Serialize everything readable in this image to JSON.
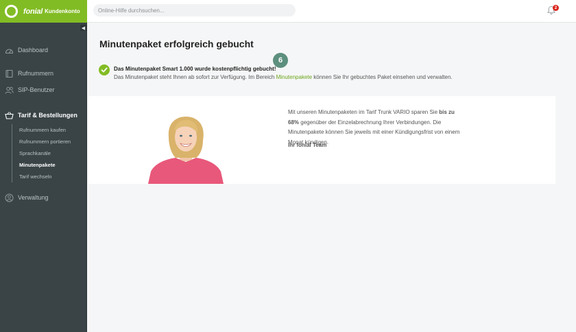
{
  "header": {
    "brand_name": "fonial",
    "brand_sub": "Kundenkonto",
    "search_placeholder": "Online-Hilfe durchsuchen...",
    "notification_count": "2"
  },
  "sidebar": {
    "items": [
      {
        "label": "Dashboard"
      },
      {
        "label": "Rufnummern"
      },
      {
        "label": "SIP-Benutzer"
      },
      {
        "label": "Tarif & Bestellungen"
      },
      {
        "label": "Verwaltung"
      }
    ],
    "subitems": [
      {
        "label": "Rufnummern kaufen"
      },
      {
        "label": "Rufnummern portieren"
      },
      {
        "label": "Sprachkanäle"
      },
      {
        "label": "Minutenpakete"
      },
      {
        "label": "Tarif wechseln"
      }
    ]
  },
  "main": {
    "title": "Minutenpaket erfolgreich gebucht",
    "step_badge": "6",
    "success_title": "Das Minutenpaket Smart 1.000 wurde kostenpflichtig gebucht!",
    "success_text_before": "Das Minutenpaket steht Ihnen ab sofort zur Verfügung. Im Bereich ",
    "success_link": "Minutenpakete",
    "success_text_after": " können Sie Ihr gebuchtes Paket einsehen und verwalten.",
    "promo_text_before": "Mit unseren Minutenpaketen im Tarif Trunk VARIO sparen Sie ",
    "promo_text_bold": "bis zu 68%",
    "promo_text_after": " gegenüber der Einzelabrechnung Ihrer Verbindungen. Die Minutenpakete können Sie jeweils mit einer Kündigungsfrist von einem Monat kündigen.",
    "promo_sign": "Ihr fonial Team"
  },
  "colors": {
    "brand_green": "#82bc24",
    "sidebar_bg": "#3a4447",
    "badge_teal": "#5d8f7e",
    "alert_red": "#d9261c"
  }
}
